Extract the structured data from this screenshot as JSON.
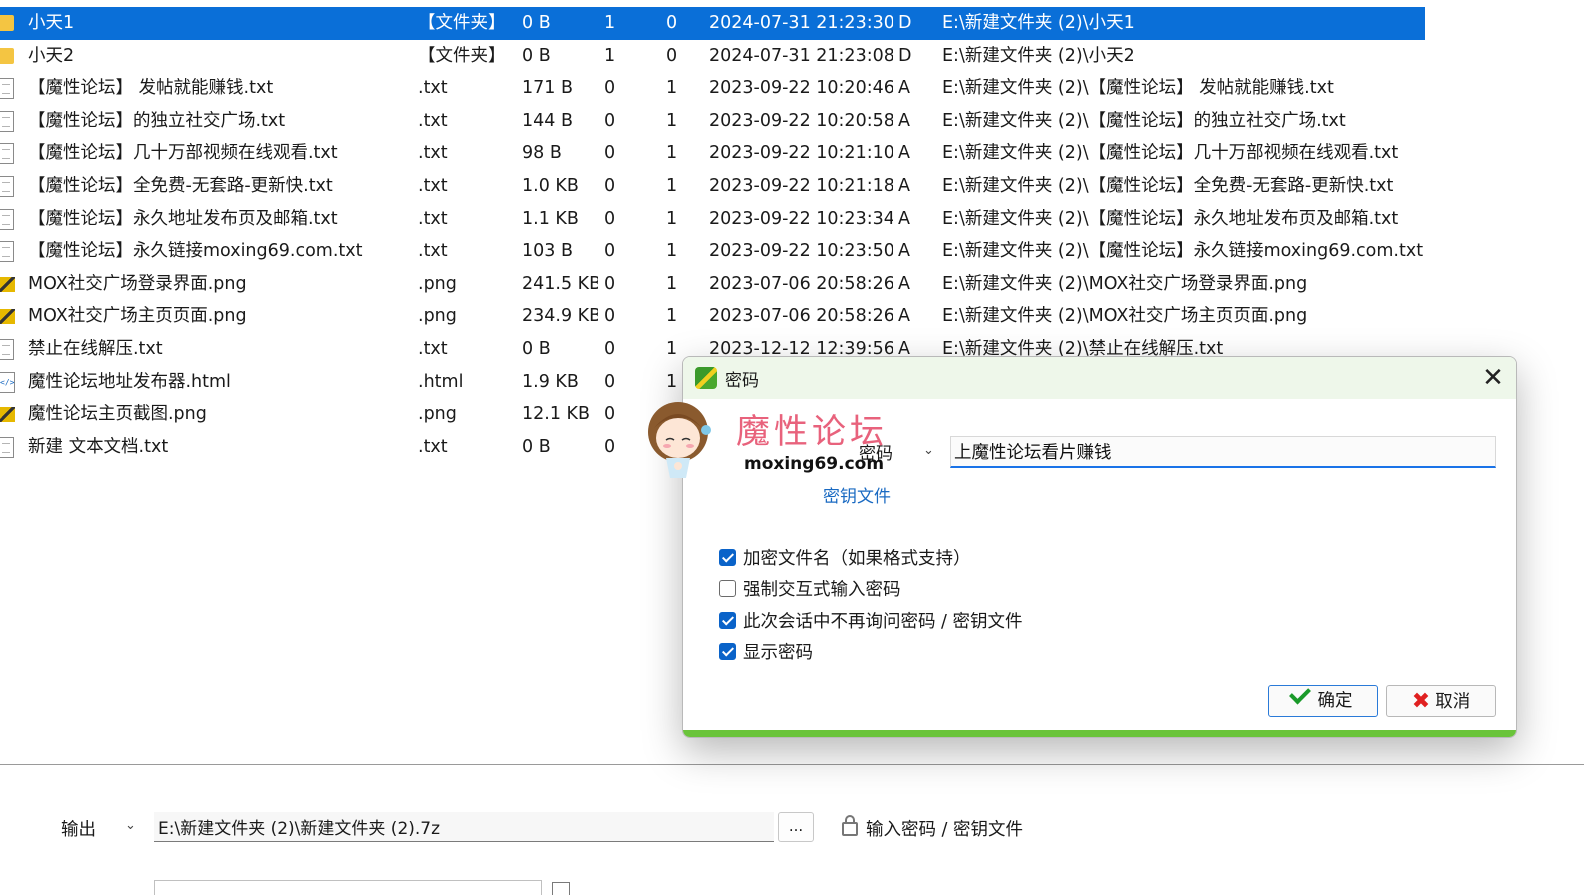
{
  "file_list": {
    "rows": [
      {
        "icon": "folder-icon",
        "name": "小天1",
        "type": "【文件夹】",
        "size": "0 B",
        "a": "1",
        "b": "0",
        "date": "2024-07-31 21:23:30",
        "attr": "D",
        "path": "E:\\新建文件夹 (2)\\小天1",
        "selected": true
      },
      {
        "icon": "folder-icon",
        "name": "小天2",
        "type": "【文件夹】",
        "size": "0 B",
        "a": "1",
        "b": "0",
        "date": "2024-07-31 21:23:08",
        "attr": "D",
        "path": "E:\\新建文件夹 (2)\\小天2",
        "selected": false
      },
      {
        "icon": "text-file-icon",
        "name": "【魔性论坛】 发帖就能赚钱.txt",
        "type": ".txt",
        "size": "171 B",
        "a": "0",
        "b": "1",
        "date": "2023-09-22 10:20:46",
        "attr": "A",
        "path": "E:\\新建文件夹 (2)\\【魔性论坛】 发帖就能赚钱.txt",
        "selected": false
      },
      {
        "icon": "text-file-icon",
        "name": "【魔性论坛】的独立社交广场.txt",
        "type": ".txt",
        "size": "144 B",
        "a": "0",
        "b": "1",
        "date": "2023-09-22 10:20:58",
        "attr": "A",
        "path": "E:\\新建文件夹 (2)\\【魔性论坛】的独立社交广场.txt",
        "selected": false
      },
      {
        "icon": "text-file-icon",
        "name": "【魔性论坛】几十万部视频在线观看.txt",
        "type": ".txt",
        "size": "98 B",
        "a": "0",
        "b": "1",
        "date": "2023-09-22 10:21:10",
        "attr": "A",
        "path": "E:\\新建文件夹 (2)\\【魔性论坛】几十万部视频在线观看.txt",
        "selected": false
      },
      {
        "icon": "text-file-icon",
        "name": "【魔性论坛】全免费-无套路-更新快.txt",
        "type": ".txt",
        "size": "1.0 KB",
        "a": "0",
        "b": "1",
        "date": "2023-09-22 10:21:18",
        "attr": "A",
        "path": "E:\\新建文件夹 (2)\\【魔性论坛】全免费-无套路-更新快.txt",
        "selected": false
      },
      {
        "icon": "text-file-icon",
        "name": "【魔性论坛】永久地址发布页及邮箱.txt",
        "type": ".txt",
        "size": "1.1 KB",
        "a": "0",
        "b": "1",
        "date": "2023-09-22 10:23:34",
        "attr": "A",
        "path": "E:\\新建文件夹 (2)\\【魔性论坛】永久地址发布页及邮箱.txt",
        "selected": false
      },
      {
        "icon": "text-file-icon",
        "name": "【魔性论坛】永久链接moxing69.com.txt",
        "type": ".txt",
        "size": "103 B",
        "a": "0",
        "b": "1",
        "date": "2023-09-22 10:23:50",
        "attr": "A",
        "path": "E:\\新建文件夹 (2)\\【魔性论坛】永久链接moxing69.com.txt",
        "selected": false
      },
      {
        "icon": "image-file-icon",
        "name": "MOX社交广场登录界面.png",
        "type": ".png",
        "size": "241.5 KB",
        "a": "0",
        "b": "1",
        "date": "2023-07-06 20:58:26",
        "attr": "A",
        "path": "E:\\新建文件夹 (2)\\MOX社交广场登录界面.png",
        "selected": false
      },
      {
        "icon": "image-file-icon",
        "name": "MOX社交广场主页页面.png",
        "type": ".png",
        "size": "234.9 KB",
        "a": "0",
        "b": "1",
        "date": "2023-07-06 20:58:26",
        "attr": "A",
        "path": "E:\\新建文件夹 (2)\\MOX社交广场主页页面.png",
        "selected": false
      },
      {
        "icon": "text-file-icon",
        "name": "禁止在线解压.txt",
        "type": ".txt",
        "size": "0 B",
        "a": "0",
        "b": "1",
        "date": "2023-12-12 12:39:56",
        "attr": "A",
        "path": "E:\\新建文件夹 (2)\\禁止在线解压.txt",
        "selected": false
      },
      {
        "icon": "html-file-icon",
        "name": "魔性论坛地址发布器.html",
        "type": ".html",
        "size": "1.9 KB",
        "a": "0",
        "b": "1",
        "date": "",
        "attr": "",
        "path": "",
        "selected": false
      },
      {
        "icon": "image-file-icon",
        "name": "魔性论坛主页截图.png",
        "type": ".png",
        "size": "12.1 KB",
        "a": "0",
        "b": "",
        "date": "",
        "attr": "",
        "path": "",
        "selected": false
      },
      {
        "icon": "text-file-icon",
        "name": "新建 文本文档.txt",
        "type": ".txt",
        "size": "0 B",
        "a": "0",
        "b": "",
        "date": "",
        "attr": "",
        "path": "",
        "selected": false
      }
    ]
  },
  "bottom": {
    "output_label": "输出",
    "output_path": "E:\\新建文件夹 (2)\\新建文件夹 (2).7z",
    "browse_label": "...",
    "password_link": "输入密码 / 密钥文件"
  },
  "dialog": {
    "title": "密码",
    "close_glyph": "✕",
    "password_label": "密码",
    "password_value": "上魔性论坛看片赚钱",
    "keyfile_link": "密钥文件",
    "options": [
      {
        "label": "加密文件名（如果格式支持）",
        "checked": true
      },
      {
        "label": "强制交互式输入密码",
        "checked": false
      },
      {
        "label": "此次会话中不再询问密码 / 密钥文件",
        "checked": true
      },
      {
        "label": "显示密码",
        "checked": true
      }
    ],
    "ok_label": "确定",
    "cancel_label": "取消",
    "accent_color": "#6ac43a"
  },
  "watermark": {
    "logo_text": "魔性论坛",
    "url": "moxing69.com"
  },
  "colors": {
    "selection": "#0a6fd8",
    "checkbox_on": "#0a63c9"
  }
}
